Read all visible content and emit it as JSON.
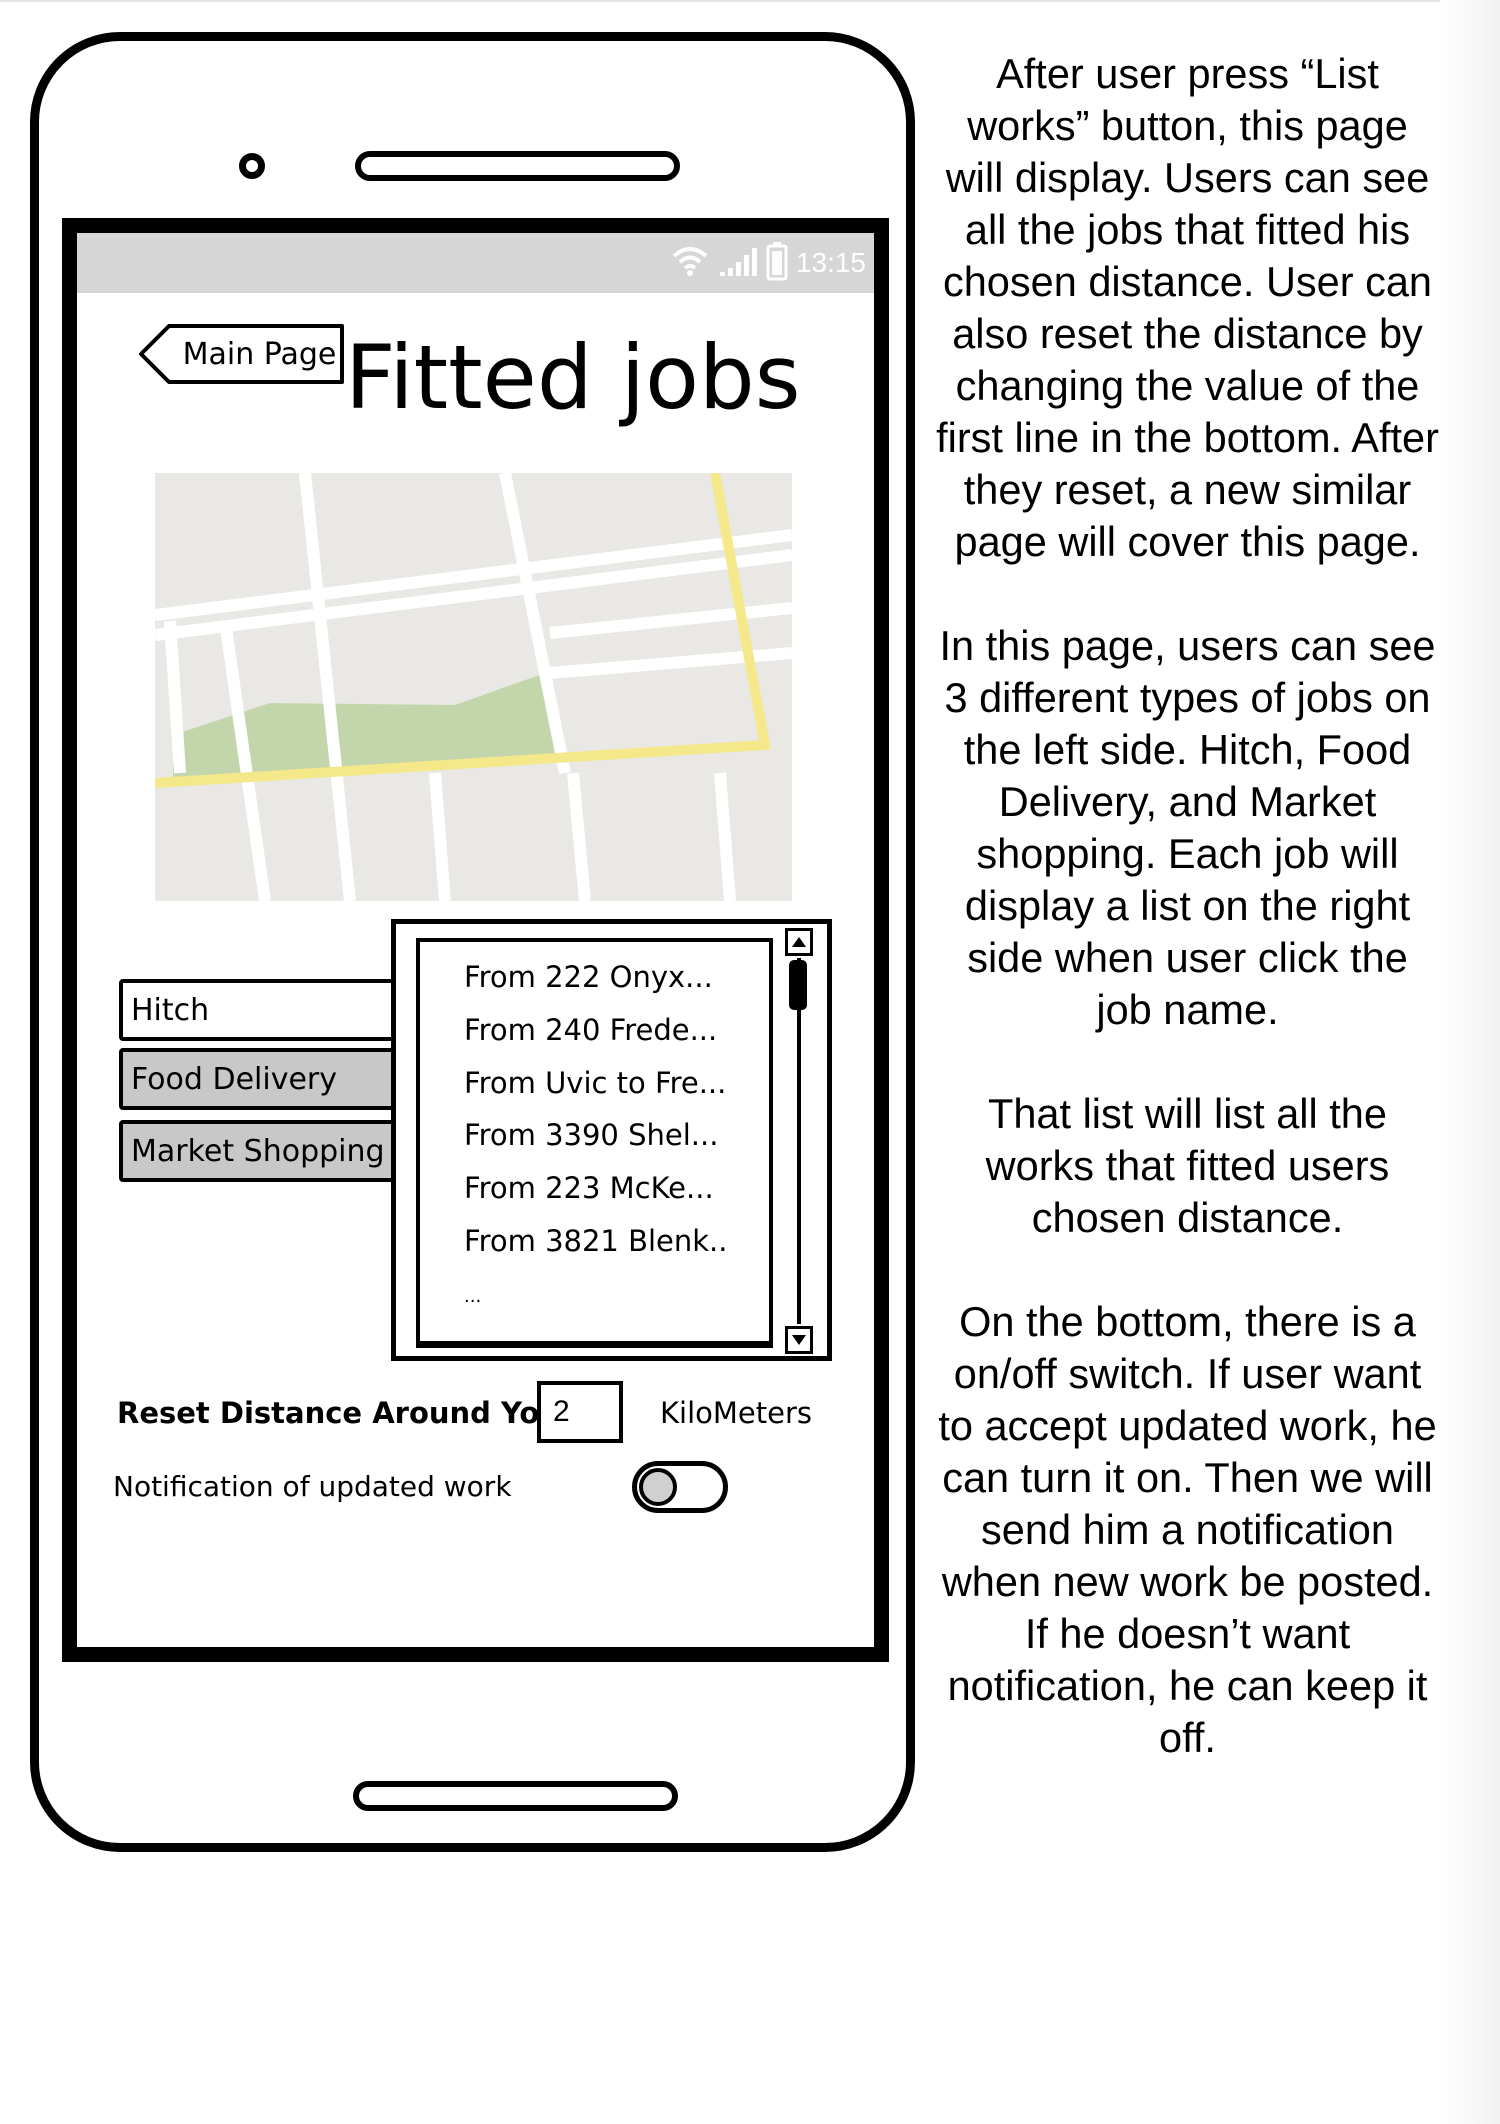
{
  "screen": {
    "status_bar": {
      "time": "13:15"
    },
    "back_button": {
      "label": "Main Page"
    },
    "title": "Fitted jobs",
    "job_types": [
      {
        "label": "Hitch",
        "selected": true
      },
      {
        "label": "Food Delivery",
        "selected": false
      },
      {
        "label": "Market Shopping",
        "selected": false
      }
    ],
    "job_list": [
      "From 222 Onyx...",
      "From 240 Frede...",
      "From Uvic to Fre...",
      "From 3390 Shel...",
      "From 223 McKe...",
      "From 3821 Blenk..",
      "..."
    ],
    "reset": {
      "label": "Reset Distance Around You",
      "value": "2",
      "unit": "KiloMeters"
    },
    "notification": {
      "label": "Notification of updated work",
      "toggle_on": false
    }
  },
  "description": [
    "After user press “List works” button, this page will display. Users can see all the jobs that fitted his chosen distance. User can also reset the distance by changing the value of the first line in the bottom. After they reset, a new similar page will cover this page.",
    "In this page, users can see 3 different types of jobs on the left side. Hitch, Food Delivery, and Market shopping. Each job will display a list on the right side when user click the job name.",
    "That list will list all the works that fitted users chosen distance.",
    "On the bottom, there is a on/off switch. If user want to accept updated work, he can turn it on. Then we will send him a notification when new work be posted. If he doesn’t want notification, he can keep it off."
  ],
  "colors": {
    "status_bar": "#d6d6d6",
    "map_background": "#e9e8e4",
    "map_road_highlight": "#f5e88a",
    "map_park": "#c3d6ab",
    "inactive_tab": "#c8c8c8"
  }
}
